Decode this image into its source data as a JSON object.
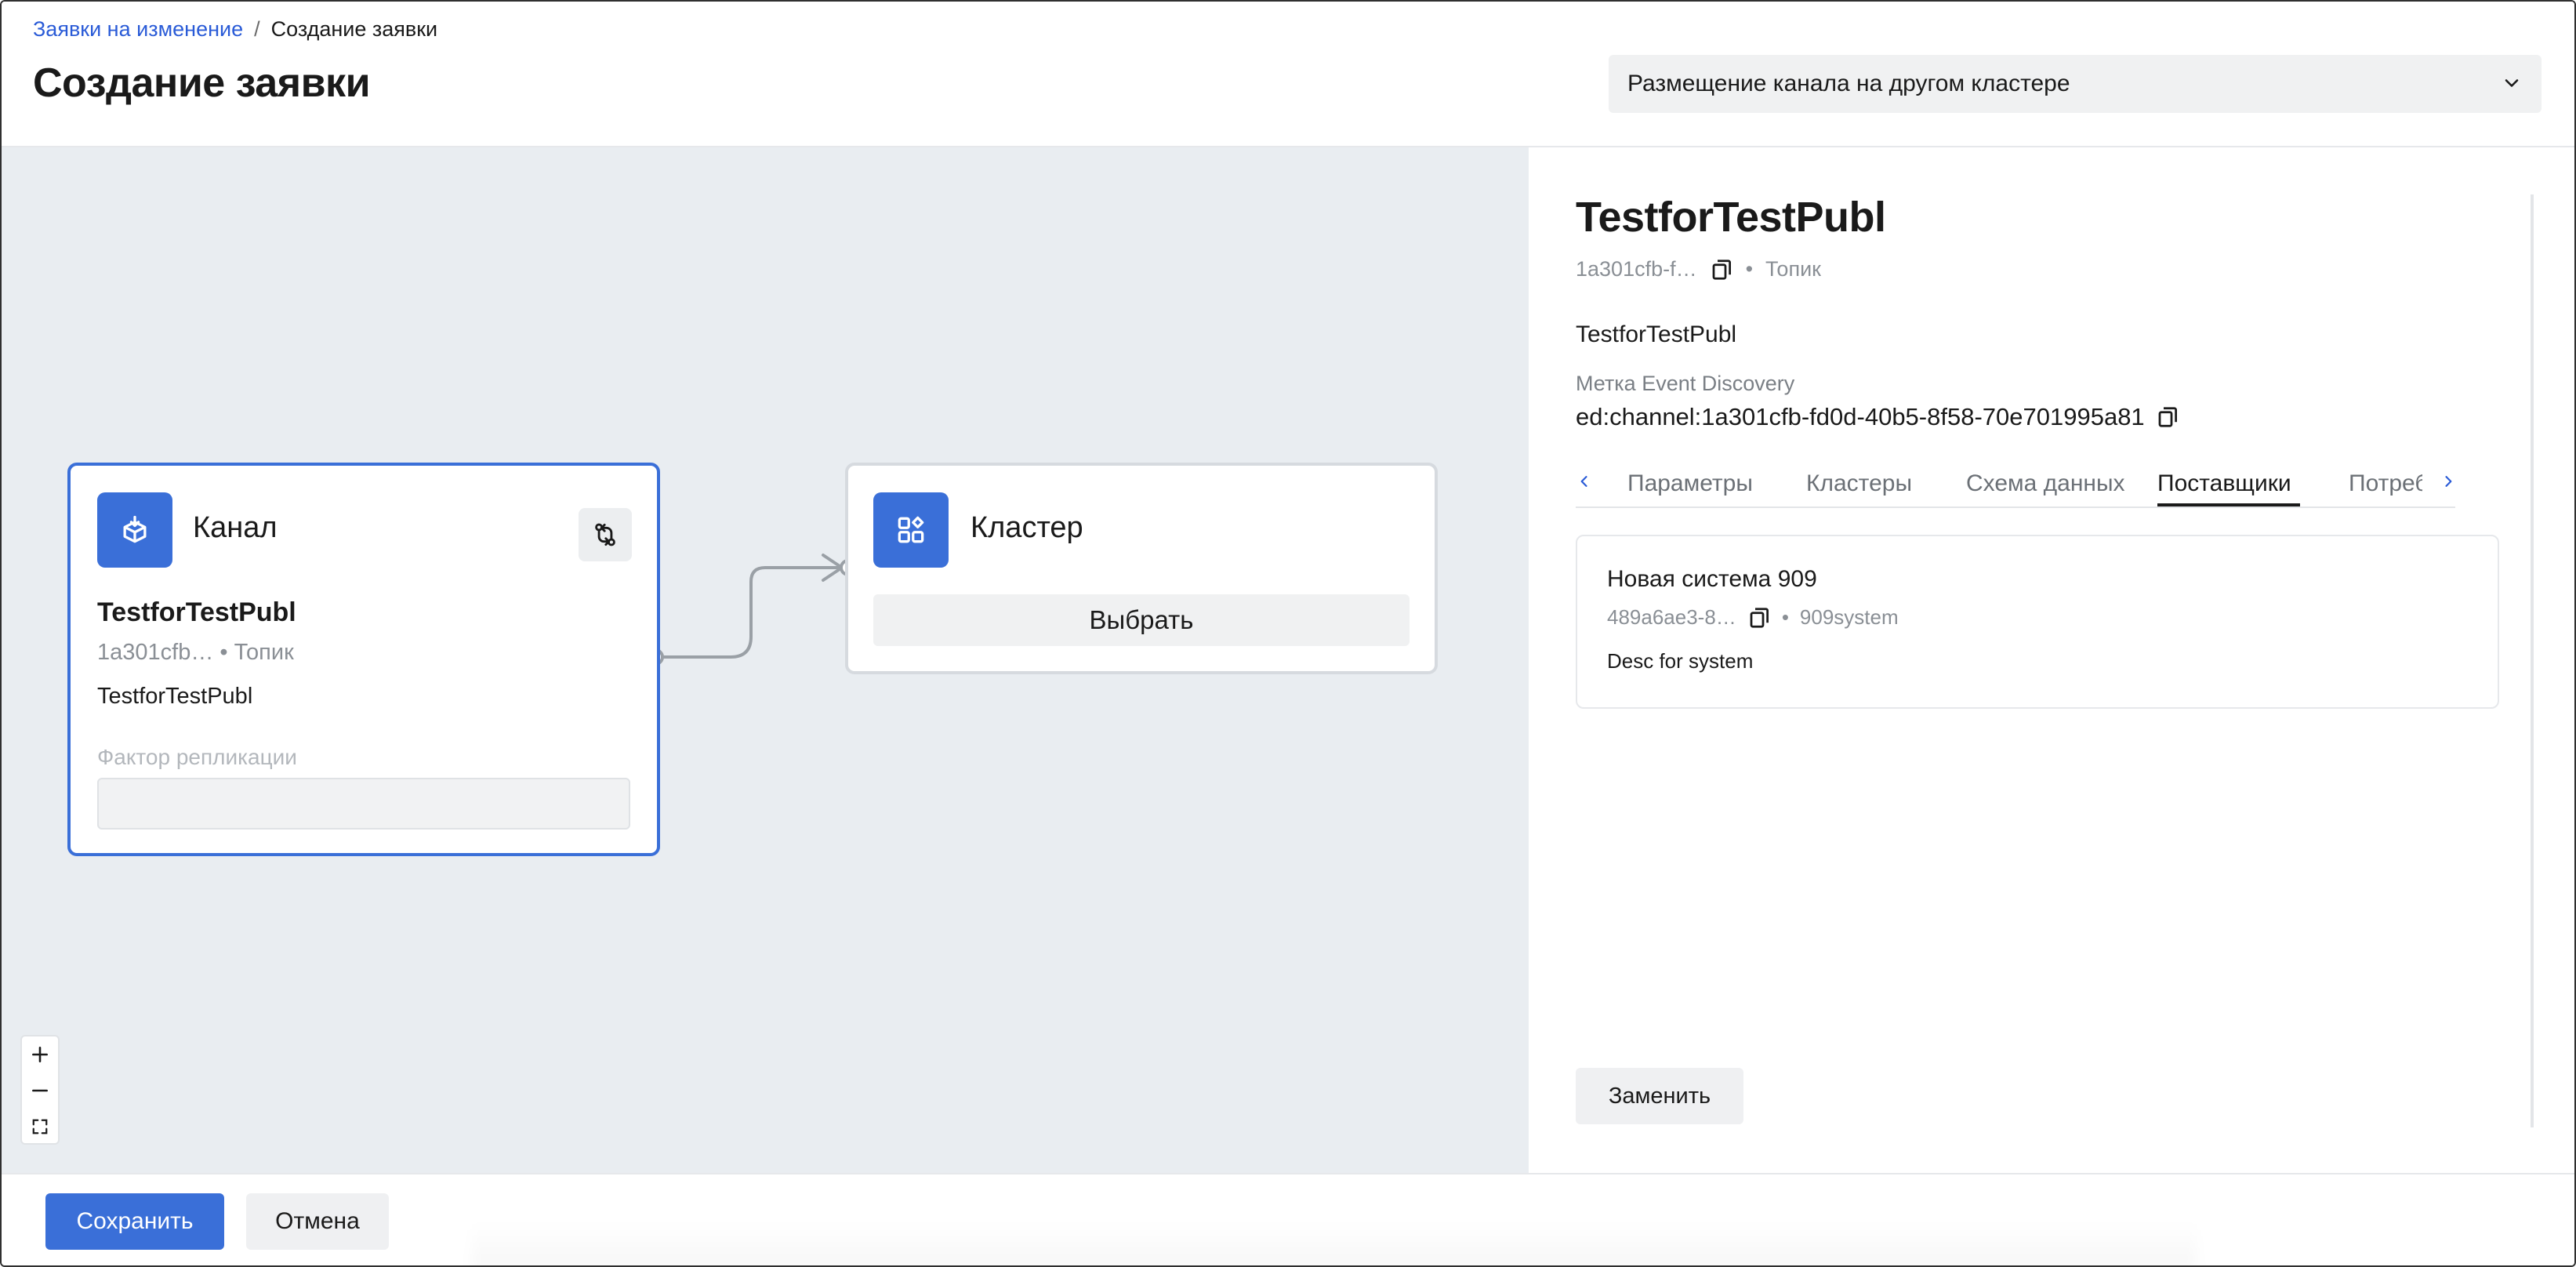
{
  "header": {
    "breadcrumb": {
      "parent": "Заявки на изменение",
      "separator": "/",
      "current": "Создание заявки"
    },
    "title": "Создание заявки",
    "request_type": {
      "selected": "Размещение канала на другом кластере"
    }
  },
  "canvas": {
    "channel_node": {
      "title": "Канал",
      "name": "TestforTestPubl",
      "meta": "1a301cfb… • Топик",
      "description": "TestforTestPubl",
      "replication_label": "Фактор репликации",
      "replication_value": ""
    },
    "cluster_node": {
      "title": "Кластер",
      "pick_label": "Выбрать"
    },
    "zoom": {
      "in": "+",
      "out": "—",
      "fit": "⛶"
    }
  },
  "panel": {
    "title": "TestforTestPubl",
    "id_short": "1a301cfb-f…",
    "meta_sep": "•",
    "type": "Топик",
    "description": "TestforTestPubl",
    "ed_label": "Метка Event Discovery",
    "ed_value": "ed:channel:1a301cfb-fd0d-40b5-8f58-70e701995a81",
    "tabs": [
      {
        "label": "Параметры",
        "active": false
      },
      {
        "label": "Кластеры",
        "active": false
      },
      {
        "label": "Схема данных",
        "active": false
      },
      {
        "label": "Поставщики",
        "active": true
      },
      {
        "label": "Потреб",
        "active": false
      }
    ],
    "supplier": {
      "name": "Новая система 909",
      "id_short": "489a6ae3-8…",
      "sep": "•",
      "code": "909system",
      "description": "Desc for system"
    },
    "replace_label": "Заменить"
  },
  "footer": {
    "save_label": "Сохранить",
    "cancel_label": "Отмена"
  },
  "colors": {
    "accent": "#3a6fd8",
    "link": "#2a5bd7",
    "canvas_bg": "#e9edf1"
  }
}
